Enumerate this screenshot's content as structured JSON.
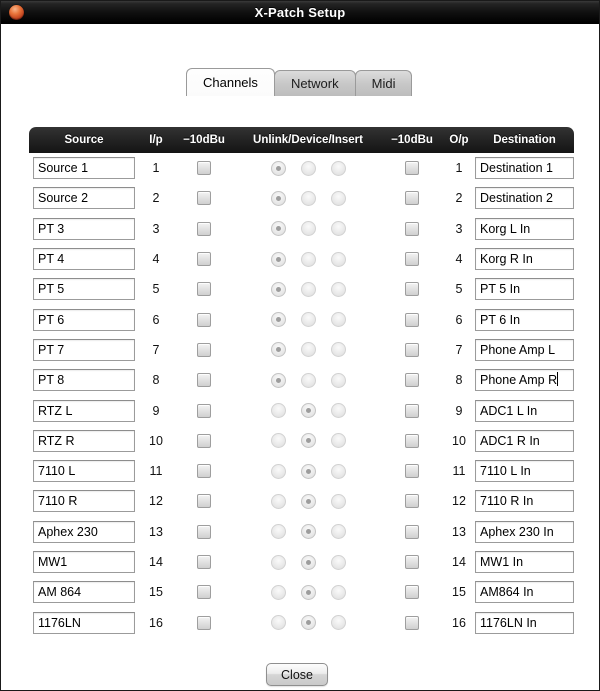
{
  "window": {
    "title": "X-Patch Setup",
    "close_icon": "close-circle-icon"
  },
  "tabs": [
    {
      "label": "Channels",
      "active": true
    },
    {
      "label": "Network",
      "active": false
    },
    {
      "label": "Midi",
      "active": false
    }
  ],
  "table": {
    "headers": {
      "source": "Source",
      "ip": "I/p",
      "dbu_in": "−10dBu",
      "unlink": "Unlink/Device/Insert",
      "dbu_out": "−10dBu",
      "op": "O/p",
      "destination": "Destination"
    },
    "radio_group_labels": [
      "Unlink",
      "Device",
      "Insert"
    ],
    "rows": [
      {
        "source": "Source 1",
        "ip": "1",
        "dbu_in": false,
        "mode": 0,
        "dbu_out": false,
        "op": "1",
        "destination": "Destination 1",
        "dest_focused": false
      },
      {
        "source": "Source 2",
        "ip": "2",
        "dbu_in": false,
        "mode": 0,
        "dbu_out": false,
        "op": "2",
        "destination": "Destination 2",
        "dest_focused": false
      },
      {
        "source": "PT 3",
        "ip": "3",
        "dbu_in": false,
        "mode": 0,
        "dbu_out": false,
        "op": "3",
        "destination": "Korg L In",
        "dest_focused": false
      },
      {
        "source": "PT 4",
        "ip": "4",
        "dbu_in": false,
        "mode": 0,
        "dbu_out": false,
        "op": "4",
        "destination": "Korg R In",
        "dest_focused": false
      },
      {
        "source": "PT 5",
        "ip": "5",
        "dbu_in": false,
        "mode": 0,
        "dbu_out": false,
        "op": "5",
        "destination": "PT 5 In",
        "dest_focused": false
      },
      {
        "source": "PT 6",
        "ip": "6",
        "dbu_in": false,
        "mode": 0,
        "dbu_out": false,
        "op": "6",
        "destination": "PT 6 In",
        "dest_focused": false
      },
      {
        "source": "PT 7",
        "ip": "7",
        "dbu_in": false,
        "mode": 0,
        "dbu_out": false,
        "op": "7",
        "destination": "Phone Amp L",
        "dest_focused": false
      },
      {
        "source": "PT 8",
        "ip": "8",
        "dbu_in": false,
        "mode": 0,
        "dbu_out": false,
        "op": "8",
        "destination": "Phone Amp R",
        "dest_focused": true
      },
      {
        "source": "RTZ L",
        "ip": "9",
        "dbu_in": false,
        "mode": 1,
        "dbu_out": false,
        "op": "9",
        "destination": "ADC1 L In",
        "dest_focused": false
      },
      {
        "source": "RTZ R",
        "ip": "10",
        "dbu_in": false,
        "mode": 1,
        "dbu_out": false,
        "op": "10",
        "destination": "ADC1 R In",
        "dest_focused": false
      },
      {
        "source": "7110 L",
        "ip": "11",
        "dbu_in": false,
        "mode": 1,
        "dbu_out": false,
        "op": "11",
        "destination": "7110 L In",
        "dest_focused": false
      },
      {
        "source": "7110 R",
        "ip": "12",
        "dbu_in": false,
        "mode": 1,
        "dbu_out": false,
        "op": "12",
        "destination": "7110 R In",
        "dest_focused": false
      },
      {
        "source": "Aphex 230",
        "ip": "13",
        "dbu_in": false,
        "mode": 1,
        "dbu_out": false,
        "op": "13",
        "destination": "Aphex 230 In",
        "dest_focused": false
      },
      {
        "source": "MW1",
        "ip": "14",
        "dbu_in": false,
        "mode": 1,
        "dbu_out": false,
        "op": "14",
        "destination": "MW1 In",
        "dest_focused": false
      },
      {
        "source": "AM 864",
        "ip": "15",
        "dbu_in": false,
        "mode": 1,
        "dbu_out": false,
        "op": "15",
        "destination": "AM864 In",
        "dest_focused": false
      },
      {
        "source": "1176LN",
        "ip": "16",
        "dbu_in": false,
        "mode": 1,
        "dbu_out": false,
        "op": "16",
        "destination": "1176LN In",
        "dest_focused": false
      }
    ]
  },
  "footer": {
    "close_label": "Close"
  },
  "colors": {
    "titlebar": "#101010",
    "header_row": "#1e1e1e",
    "accent_close": "#e8743a",
    "page_background": "#ffffff"
  }
}
